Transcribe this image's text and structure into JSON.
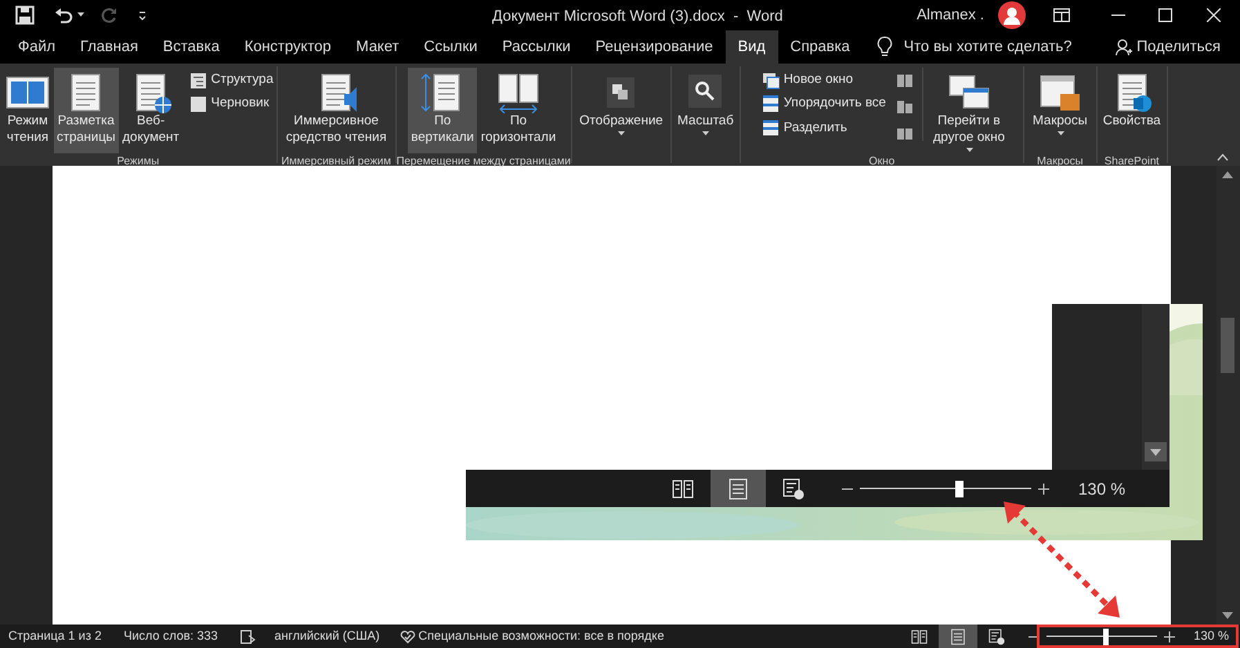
{
  "title_bar": {
    "title": "Документ Microsoft Word (3).docx  -  Word",
    "user": "Almanex ."
  },
  "tabs": [
    {
      "label": "Файл",
      "selected": false
    },
    {
      "label": "Главная",
      "selected": false
    },
    {
      "label": "Вставка",
      "selected": false
    },
    {
      "label": "Конструктор",
      "selected": false
    },
    {
      "label": "Макет",
      "selected": false
    },
    {
      "label": "Ссылки",
      "selected": false
    },
    {
      "label": "Рассылки",
      "selected": false
    },
    {
      "label": "Рецензирование",
      "selected": false
    },
    {
      "label": "Вид",
      "selected": true
    },
    {
      "label": "Справка",
      "selected": false
    }
  ],
  "search": {
    "placeholder": "Что вы хотите сделать?"
  },
  "share": "Поделиться",
  "ribbon_groups": [
    {
      "label": "Режимы",
      "items": [
        {
          "kind": "large",
          "lines": [
            "Режим",
            "чтения"
          ],
          "selected": false
        },
        {
          "kind": "large",
          "lines": [
            "Разметка",
            "страницы"
          ],
          "selected": true
        },
        {
          "kind": "large",
          "lines": [
            "Веб-",
            "документ"
          ],
          "selected": false
        },
        {
          "kind": "small",
          "label": "Структура"
        },
        {
          "kind": "small",
          "label": "Черновик"
        }
      ]
    },
    {
      "label": "Иммерсивный режим",
      "items": [
        {
          "kind": "large",
          "lines": [
            "Иммерсивное",
            "средство чтения"
          ],
          "selected": false
        }
      ]
    },
    {
      "label": "Перемещение между страницами",
      "items": [
        {
          "kind": "large",
          "lines": [
            "По",
            "вертикали"
          ],
          "selected": true
        },
        {
          "kind": "large",
          "lines": [
            "По",
            "горизонтали"
          ],
          "selected": false
        }
      ]
    },
    {
      "items": [
        {
          "kind": "large",
          "lines": [
            "Отображение"
          ],
          "selected": false,
          "dropdown": true
        }
      ]
    },
    {
      "items": [
        {
          "kind": "large",
          "lines": [
            "Масштаб"
          ],
          "selected": false,
          "dropdown": true
        }
      ]
    },
    {
      "label": "Окно",
      "items": [
        {
          "kind": "small",
          "label": "Новое окно"
        },
        {
          "kind": "small",
          "label": "Упорядочить все"
        },
        {
          "kind": "small",
          "label": "Разделить"
        },
        {
          "kind": "icon"
        },
        {
          "kind": "icon"
        },
        {
          "kind": "icon"
        },
        {
          "kind": "large",
          "lines": [
            "Перейти в",
            "другое окно"
          ],
          "selected": false,
          "dropdown": true
        }
      ]
    },
    {
      "label": "Макросы",
      "items": [
        {
          "kind": "large",
          "lines": [
            "Макросы"
          ],
          "selected": false,
          "dropdown": true
        }
      ]
    },
    {
      "label": "SharePoint",
      "items": [
        {
          "kind": "large",
          "lines": [
            "Свойства"
          ],
          "selected": false
        }
      ]
    }
  ],
  "status_bar": {
    "page": "Страница 1 из 2",
    "words": "Число слов: 333",
    "language": "английский (США)",
    "accessibility": "Специальные возможности: все в порядке",
    "views": [
      {
        "selected": false
      },
      {
        "selected": true
      },
      {
        "selected": false
      }
    ],
    "zoom": {
      "level": 0.53,
      "reading": "130 %"
    }
  },
  "zoomed_inset": {
    "views": [
      {
        "selected": false
      },
      {
        "selected": true
      },
      {
        "selected": false
      }
    ],
    "zoom": {
      "level": 0.57,
      "reading": "130 %"
    }
  }
}
